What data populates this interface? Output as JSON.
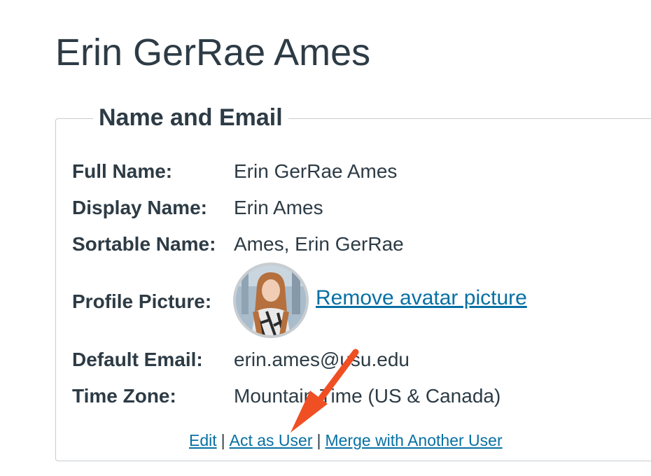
{
  "user": {
    "title": "Erin GerRae Ames"
  },
  "section": {
    "legend": "Name and Email"
  },
  "fields": [
    {
      "label": "Full Name:",
      "value": "Erin GerRae Ames"
    },
    {
      "label": "Display Name:",
      "value": "Erin Ames"
    },
    {
      "label": "Sortable Name:",
      "value": "Ames, Erin GerRae"
    },
    {
      "label": "Profile Picture:",
      "value": ""
    },
    {
      "label": "Default Email:",
      "value": "erin.ames@usu.edu"
    },
    {
      "label": "Time Zone:",
      "value": "Mountain Time (US & Canada)"
    }
  ],
  "profile": {
    "remove_link": "Remove avatar picture"
  },
  "actions": {
    "edit": "Edit",
    "act_as_user": "Act as User",
    "merge": "Merge with Another User",
    "separator": "|"
  },
  "colors": {
    "text": "#2d3b45",
    "link": "#0770a3",
    "border": "#c7cdd1",
    "annotation_arrow": "#f04e23"
  },
  "icons": {
    "annotation": "red-arrow-icon"
  }
}
